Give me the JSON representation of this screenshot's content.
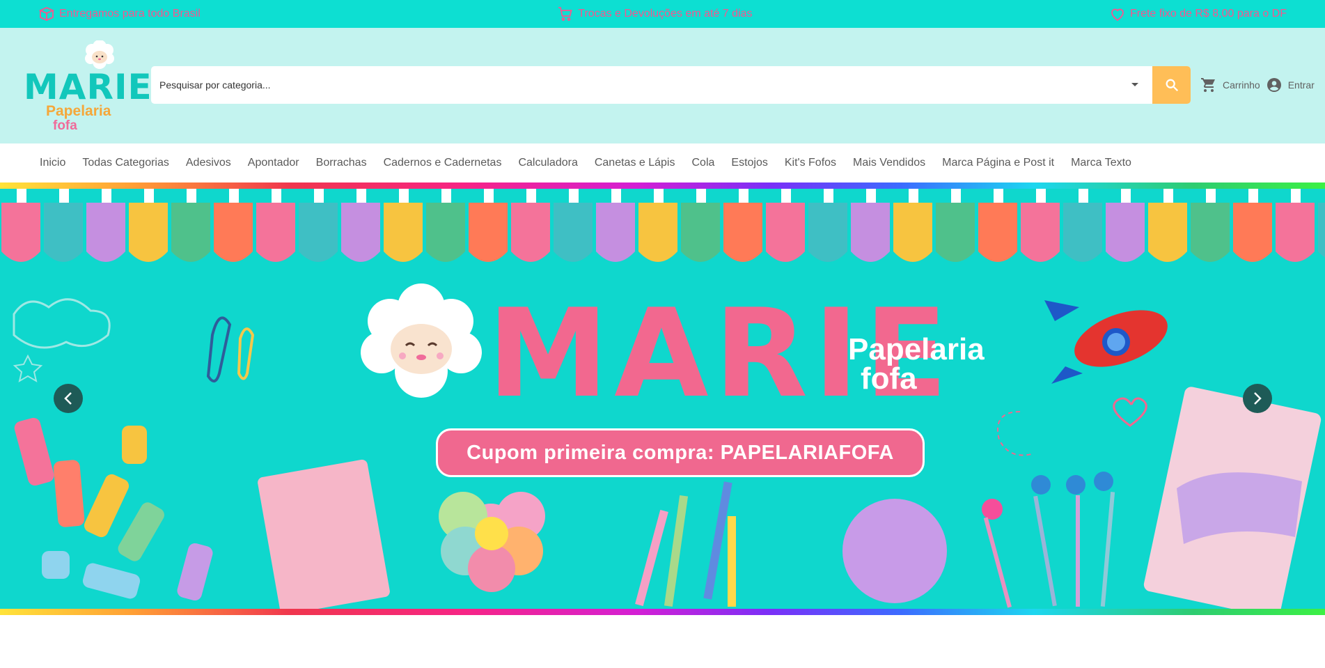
{
  "topbar": {
    "items": [
      {
        "label": "Entregamos para todo Brasil",
        "icon": "package-icon"
      },
      {
        "label": "Trocas e Devoluções em até 7 dias",
        "icon": "cart-icon"
      },
      {
        "label": "Frete fixo de R$ 8,00 para o DF",
        "icon": "heart-icon"
      }
    ],
    "background": "#0ddfd2",
    "text_color": "#f5568f"
  },
  "header": {
    "logo": {
      "brand": "MARIE",
      "line1": "Papelaria",
      "line2": "fofa"
    },
    "search": {
      "placeholder": "Pesquisar por categoria...",
      "button_color": "#ffbe57"
    },
    "cart_label": "Carrinho",
    "login_label": "Entrar",
    "background": "#c3f3ef"
  },
  "nav": {
    "items": [
      "Inicio",
      "Todas Categorias",
      "Adesivos",
      "Apontador",
      "Borrachas",
      "Cadernos e Cadernetas",
      "Calculadora",
      "Canetas e Lápis",
      "Cola",
      "Estojos",
      "Kit's Fofos",
      "Mais Vendidos",
      "Marca Página e Post it",
      "Marca Texto"
    ]
  },
  "hero": {
    "brand": "MARIE",
    "tagline_line1": "Papelaria",
    "tagline_line2": "fofa",
    "coupon_text": "Cupom  primeira compra: PAPELARIAFOFA",
    "background": "#0fd7cd",
    "accent": "#f0688f"
  }
}
